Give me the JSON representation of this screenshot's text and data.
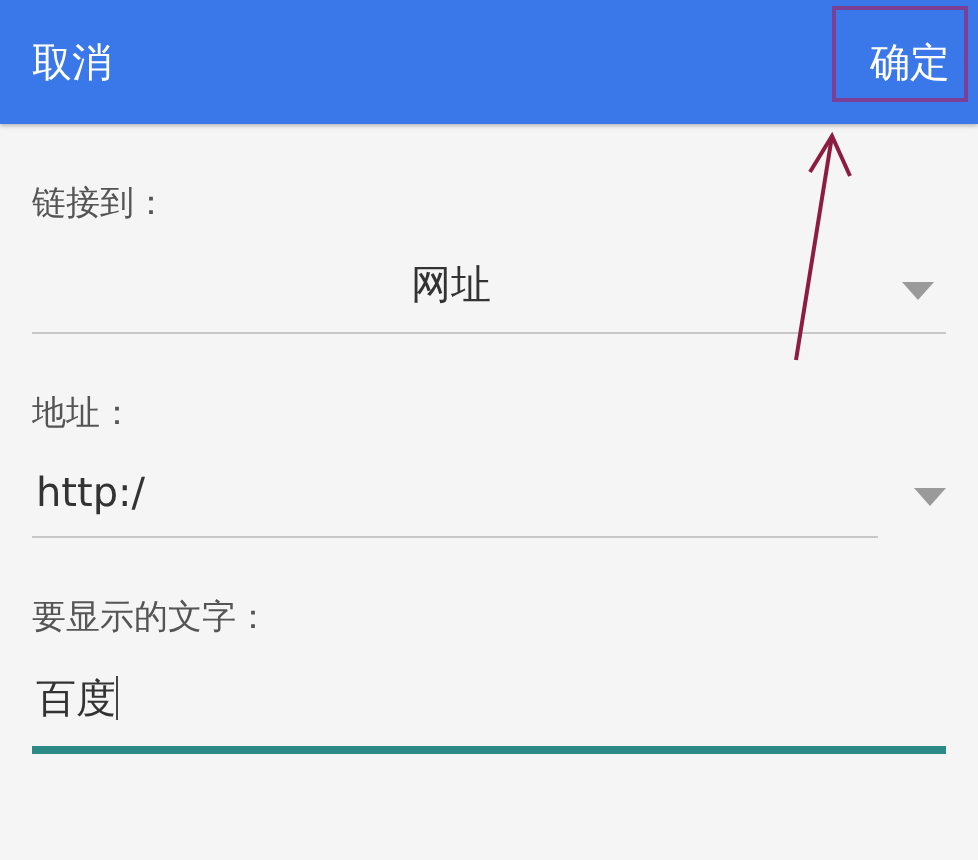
{
  "top_bar": {
    "cancel": "取消",
    "confirm": "确定"
  },
  "fields": [
    {
      "kind": "select",
      "label": "链接到：",
      "value": "网址"
    },
    {
      "kind": "combo",
      "label": "地址：",
      "value": "http:/"
    },
    {
      "kind": "text",
      "label": "要显示的文字：",
      "value": "百度",
      "focused": true
    }
  ]
}
